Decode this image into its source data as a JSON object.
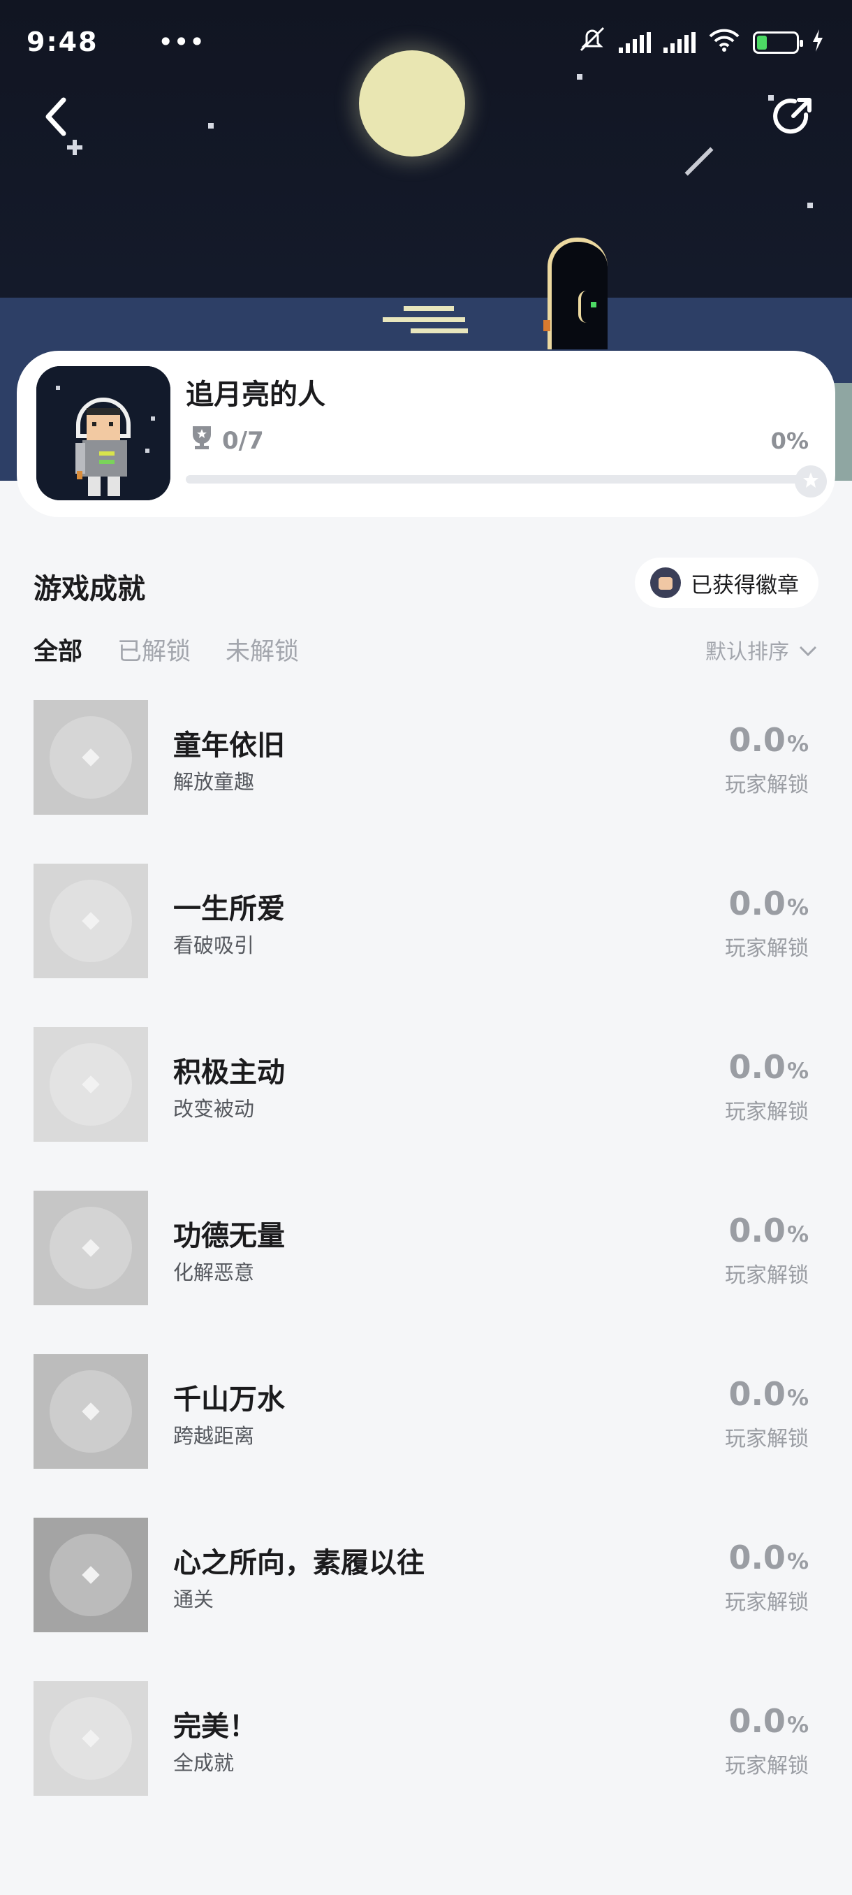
{
  "status_bar": {
    "time": "9:48",
    "notification_dots": "•••",
    "icons": [
      "mute-bell-icon",
      "signal-icon",
      "signal-icon",
      "wifi-icon",
      "battery-icon",
      "charging-icon"
    ]
  },
  "header": {
    "back_icon": "chevron-left-icon",
    "share_icon": "share-icon"
  },
  "game": {
    "title": "追月亮的人",
    "trophy_icon": "trophy-icon",
    "progress_text": "0/7",
    "percent_text": "0%",
    "progress_fraction": 0.0
  },
  "section": {
    "title": "游戏成就",
    "badge_button_label": "已获得徽章"
  },
  "tabs": [
    "全部",
    "已解锁",
    "未解锁"
  ],
  "active_tab": 0,
  "sort": {
    "label": "默认排序",
    "icon": "chevron-down-icon"
  },
  "achievements": [
    {
      "title": "童年依旧",
      "desc": "解放童趣",
      "rate": "0.0",
      "unit": "%",
      "caption": "玩家解锁",
      "tone": "#c9c9c9"
    },
    {
      "title": "一生所爱",
      "desc": "看破吸引",
      "rate": "0.0",
      "unit": "%",
      "caption": "玩家解锁",
      "tone": "#d6d6d6"
    },
    {
      "title": "积极主动",
      "desc": "改变被动",
      "rate": "0.0",
      "unit": "%",
      "caption": "玩家解锁",
      "tone": "#dadada"
    },
    {
      "title": "功德无量",
      "desc": "化解恶意",
      "rate": "0.0",
      "unit": "%",
      "caption": "玩家解锁",
      "tone": "#c6c6c6"
    },
    {
      "title": "千山万水",
      "desc": "跨越距离",
      "rate": "0.0",
      "unit": "%",
      "caption": "玩家解锁",
      "tone": "#bcbcbc"
    },
    {
      "title": "心之所向，素履以往",
      "desc": "通关",
      "rate": "0.0",
      "unit": "%",
      "caption": "玩家解锁",
      "tone": "#a4a4a4"
    },
    {
      "title": "完美！",
      "desc": "全成就",
      "rate": "0.0",
      "unit": "%",
      "caption": "玩家解锁",
      "tone": "#d9d9d9"
    }
  ]
}
